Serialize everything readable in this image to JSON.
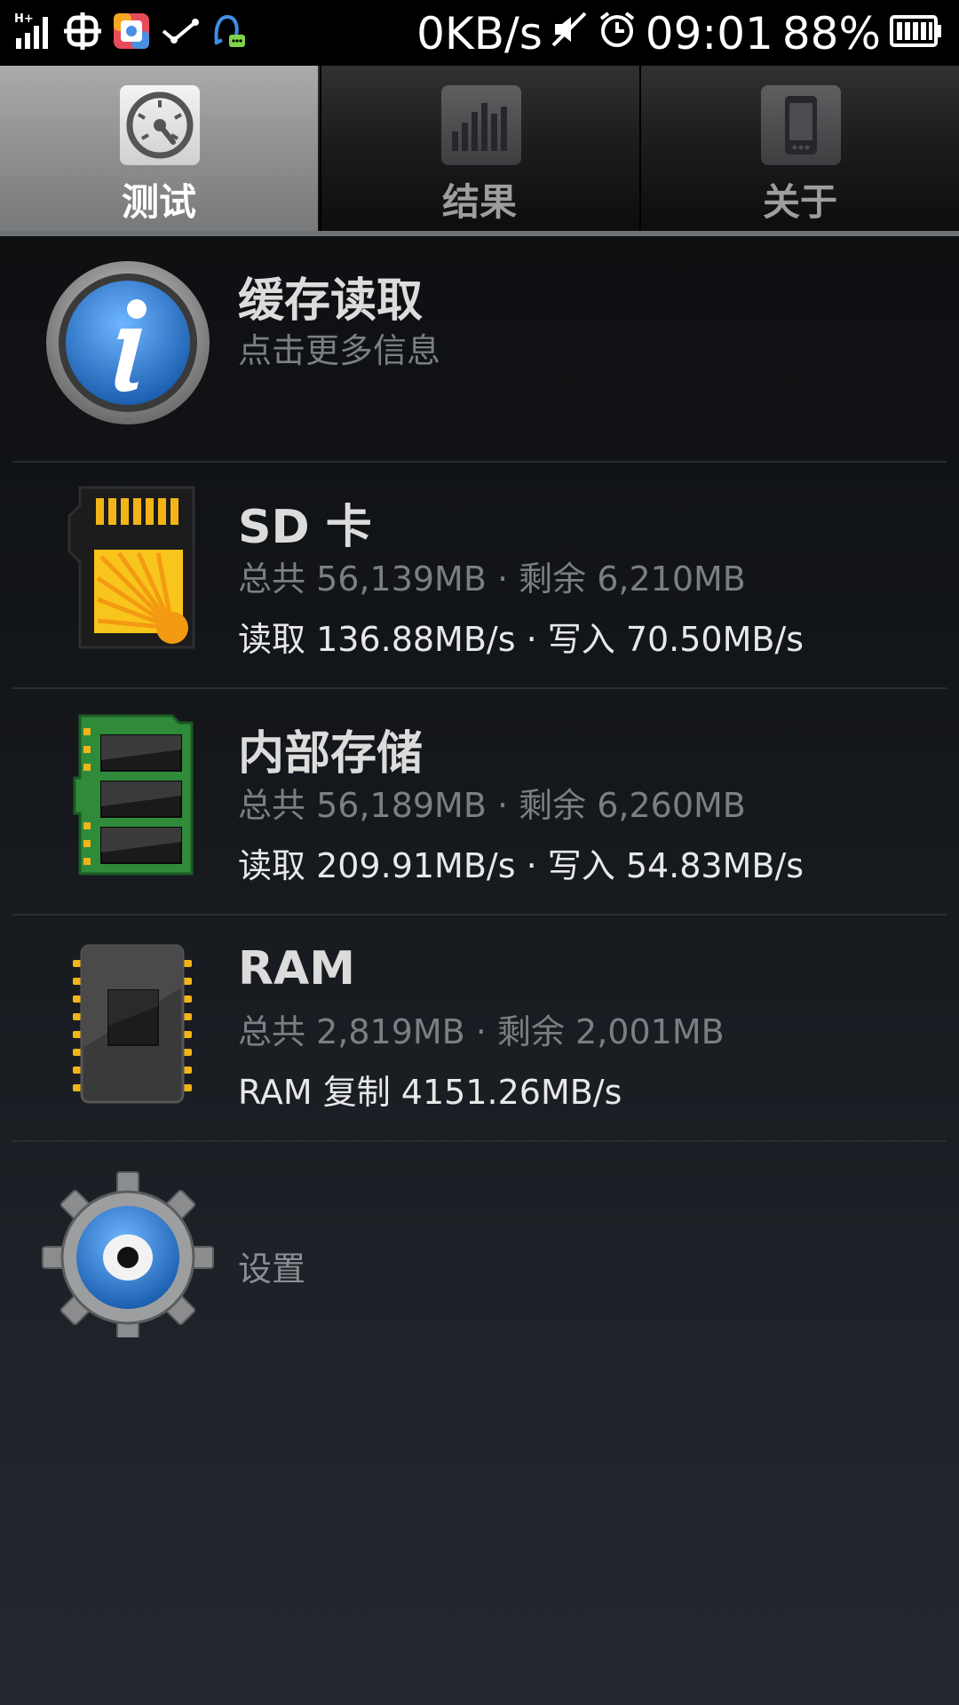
{
  "status_bar": {
    "network_type": "H+",
    "network_speed": "0KB/s",
    "time": "09:01",
    "battery": "88%",
    "icons": [
      "signal-icon",
      "unicom-icon",
      "app-store-icon",
      "sync-icon",
      "qq-icon",
      "mute-icon",
      "alarm-icon",
      "battery-icon"
    ]
  },
  "tabs": [
    {
      "label": "测试",
      "icon": "speedometer-icon",
      "active": true
    },
    {
      "label": "结果",
      "icon": "bar-chart-icon",
      "active": false
    },
    {
      "label": "关于",
      "icon": "phone-icon",
      "active": false
    }
  ],
  "rows": {
    "cache": {
      "title": "缓存读取",
      "subtitle": "点击更多信息",
      "icon": "info-icon"
    },
    "sd": {
      "title": "SD 卡",
      "capacity": "总共 56,139MB · 剩余 6,210MB",
      "speed": "读取 136.88MB/s · 写入 70.50MB/s",
      "icon": "sd-card-icon"
    },
    "internal": {
      "title": "内部存储",
      "capacity": "总共 56,189MB · 剩余 6,260MB",
      "speed": "读取 209.91MB/s · 写入 54.83MB/s",
      "icon": "memory-module-icon"
    },
    "ram": {
      "title": "RAM",
      "capacity": "总共 2,819MB · 剩余 2,001MB",
      "speed": "RAM 复制 4151.26MB/s",
      "icon": "chip-icon"
    },
    "settings": {
      "label": "设置",
      "icon": "gear-icon"
    }
  },
  "colors": {
    "accent_blue": "#2f7fd0",
    "sd_gold": "#f6b51a",
    "pcb_green": "#2f8a3a"
  }
}
